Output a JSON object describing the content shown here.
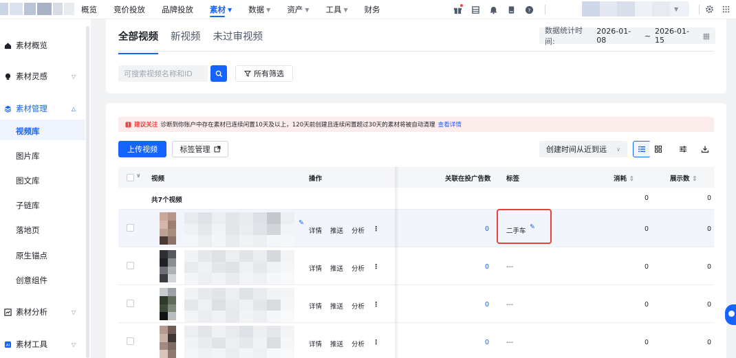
{
  "nav": {
    "items": [
      {
        "label": "概览",
        "caret": false
      },
      {
        "label": "竞价投放",
        "caret": false
      },
      {
        "label": "品牌投放",
        "caret": false
      },
      {
        "label": "素材",
        "caret": true,
        "active": true
      },
      {
        "label": "数据",
        "caret": true
      },
      {
        "label": "资产",
        "caret": true
      },
      {
        "label": "工具",
        "caret": true
      },
      {
        "label": "财务",
        "caret": false
      }
    ]
  },
  "sidebar": {
    "groups": {
      "overview": "素材概览",
      "inspiration": "素材灵感",
      "management": "素材管理",
      "analysis": "素材分析",
      "tools": "素材工具"
    },
    "items": [
      "视频库",
      "图片库",
      "图文库",
      "子链库",
      "落地页",
      "原生锚点",
      "创意组件"
    ]
  },
  "tabs": [
    "全部视频",
    "新视频",
    "未过审视频"
  ],
  "date_range": {
    "label": "数据统计时间:",
    "start": "2026-01-08",
    "sep": "~",
    "end": "2026-01-15"
  },
  "search": {
    "placeholder": "可搜索视频名称和ID"
  },
  "filter_label": "所有筛选",
  "notice": {
    "tag": "建议关注",
    "text": "诊断到你账户中存在素材已连续闲置10天及以上，120天前创建且连续闲置超过30天的素材将被自动清理",
    "link": "查看详情"
  },
  "toolbar": {
    "upload": "上传视频",
    "tag_manage": "标签管理",
    "sort": "创建时间从近到远"
  },
  "table": {
    "headers": {
      "video": "视频",
      "actions": "操作",
      "ads_count": "关联在投广告数",
      "tags": "标签",
      "cost": "消耗",
      "impressions": "展示数"
    },
    "total": {
      "label": "共7个视频",
      "cost": "0",
      "impressions": "0"
    },
    "actions": [
      "详情",
      "推送",
      "分析"
    ],
    "rows": [
      {
        "ads": "0",
        "tag": "二手车",
        "cost": "0",
        "impressions": "0"
      },
      {
        "ads": "0",
        "tag": "---",
        "cost": "0",
        "impressions": "0"
      },
      {
        "ads": "0",
        "tag": "---",
        "cost": "0",
        "impressions": "0"
      },
      {
        "ads": "0",
        "tag": "---",
        "cost": "0",
        "impressions": "0"
      }
    ]
  },
  "colors": {
    "accent": "#1664ff",
    "warning": "#f53f3f",
    "highlight_border": "#e8413c"
  }
}
